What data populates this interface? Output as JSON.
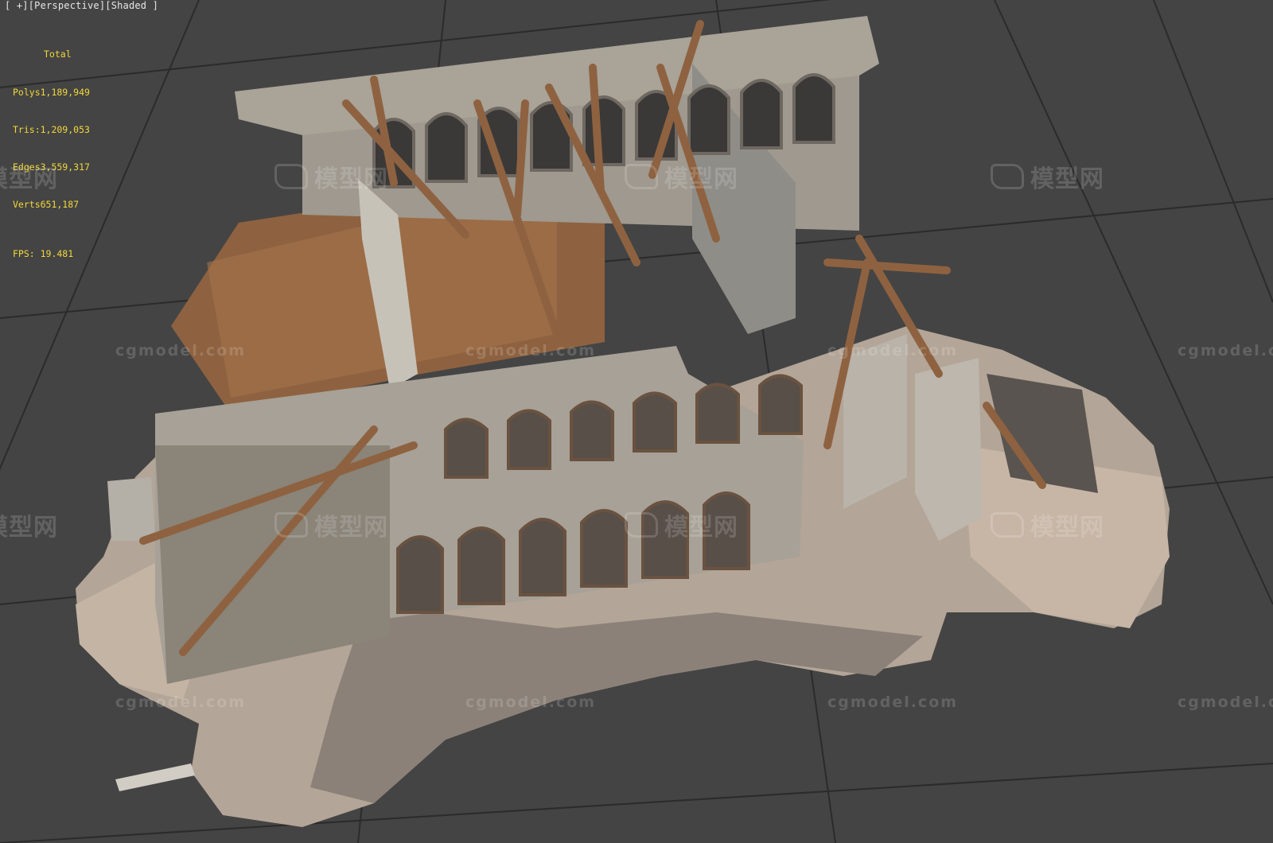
{
  "viewport": {
    "label_parts": [
      "[ ",
      "+",
      "][",
      "Perspective",
      "][",
      "Shaded",
      " ]"
    ],
    "background": "#444444",
    "grid_color": "#2a2a2a"
  },
  "stats": {
    "title": "Total",
    "polys": "Polys1,189,949",
    "tris": "Tris:1,209,053",
    "edges": "Edges3,559,317",
    "verts": "Verts651,187",
    "fps": "FPS: 19.481",
    "color": "#f2d83a"
  },
  "watermarks": {
    "site": "cgmodel.com",
    "brand": "模型网"
  },
  "colors": {
    "stone": "#b6b0a6",
    "stone_dark": "#8a847a",
    "wood": "#8e6240",
    "wood_light": "#a8784f",
    "rubble": "#c9bcad",
    "rubble_dark": "#7e766d"
  }
}
